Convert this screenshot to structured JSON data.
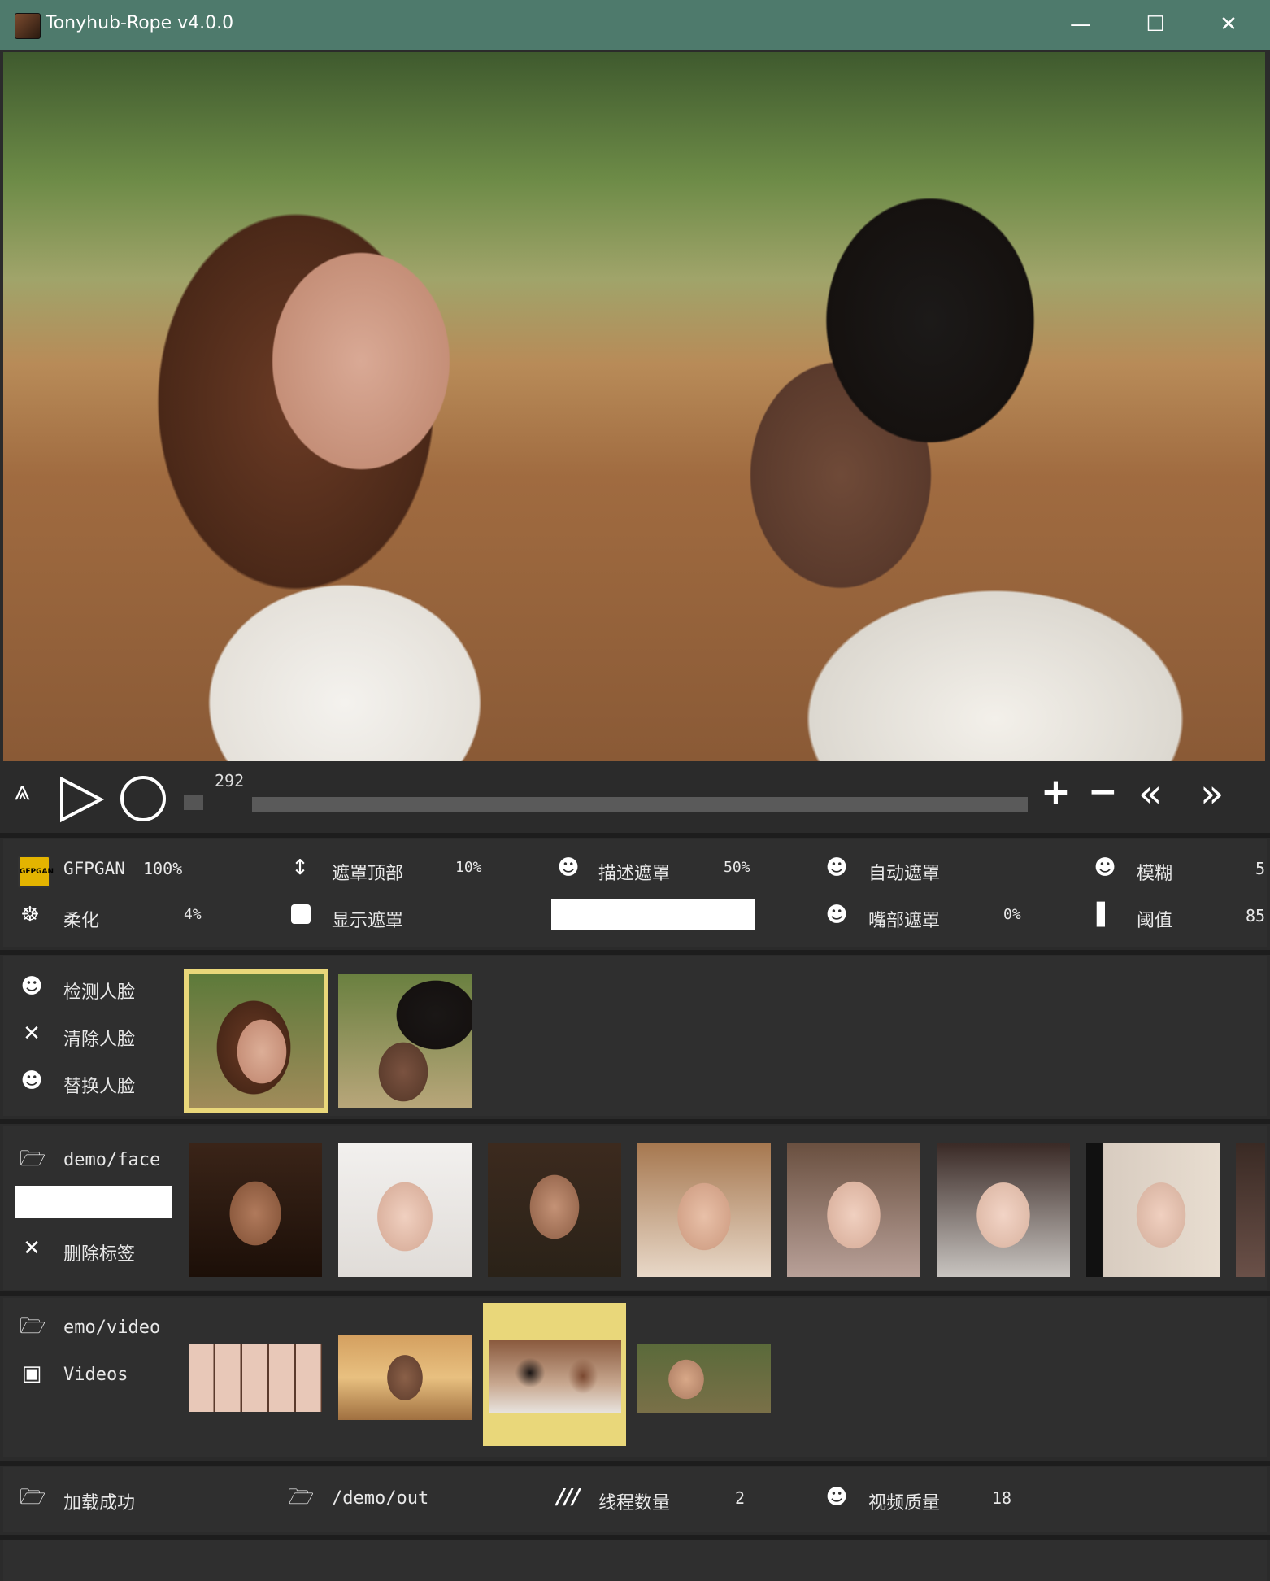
{
  "window": {
    "title": "Tonyhub-Rope v4.0.0",
    "minimize": "—",
    "maximize": "☐",
    "close": "✕"
  },
  "player": {
    "frame": "292"
  },
  "settings": {
    "gfpgan_label": "GFPGAN",
    "gfpgan_value": "100%",
    "mask_top_label": "遮罩顶部",
    "mask_top_value": "10%",
    "describe_mask_label": "描述遮罩",
    "describe_mask_value": "50%",
    "auto_mask_label": "自动遮罩",
    "blur_label": "模糊",
    "blur_value": "5",
    "soften_label": "柔化",
    "soften_value": "4%",
    "show_mask_label": "显示遮罩",
    "mouth_mask_label": "嘴部遮罩",
    "mouth_mask_value": "0%",
    "threshold_label": "阈值",
    "threshold_value": "85"
  },
  "faces": {
    "detect_label": "检测人脸",
    "clear_label": "清除人脸",
    "swap_label": "替换人脸"
  },
  "source_faces": {
    "folder_label": "demo/face",
    "delete_tag_label": "删除标签"
  },
  "videos": {
    "folder_label": "emo/video",
    "videos_label": "Videos"
  },
  "status": {
    "load_label": "加载成功",
    "output_label": "/demo/out",
    "threads_label": "线程数量",
    "threads_value": "2",
    "quality_label": "视频质量",
    "quality_value": "18"
  },
  "colors": {
    "titlebar": "#4e7a6c",
    "background": "#2b2b2b",
    "selection": "#e9d77a"
  },
  "icons": [
    "app-icon",
    "collapse-icon",
    "play-icon",
    "record-icon",
    "plus-icon",
    "minus-icon",
    "rewind-icon",
    "forward-icon",
    "folder-icon",
    "person-icon",
    "checkbox-icon",
    "threads-icon",
    "cross-icon"
  ]
}
